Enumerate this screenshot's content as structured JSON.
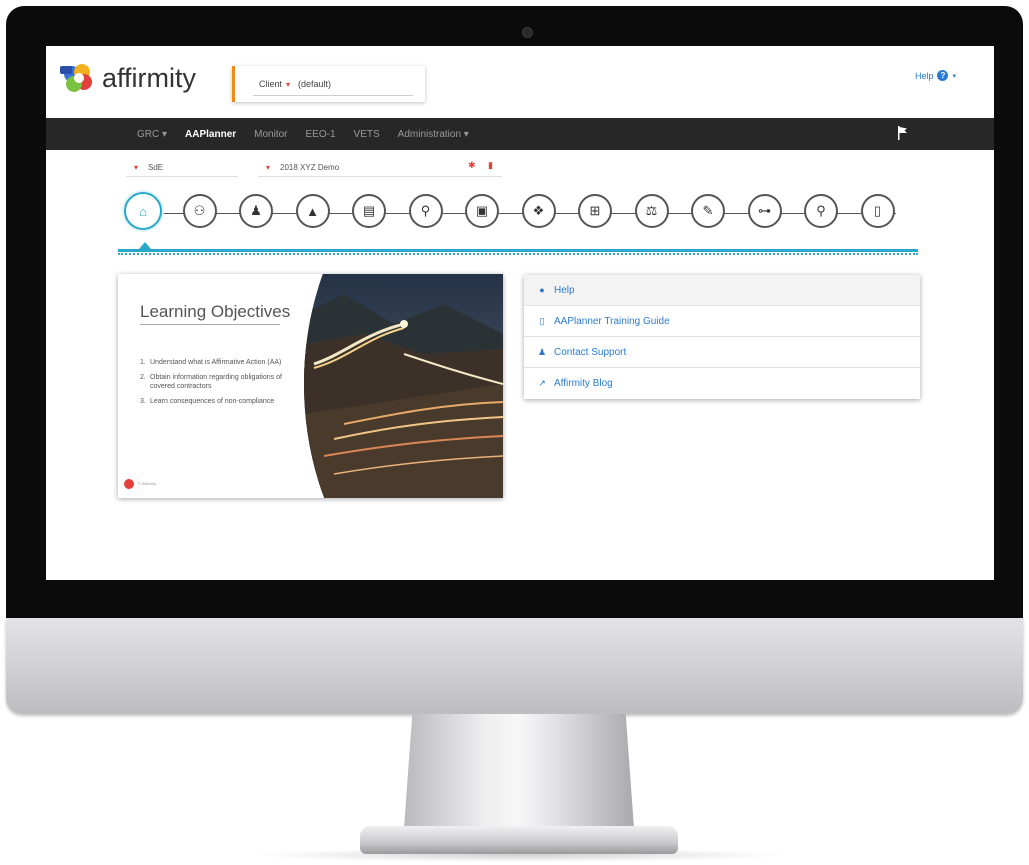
{
  "header": {
    "logo_text": "affirmity",
    "client_label": "Client",
    "client_value": "(default)",
    "help_label": "Help"
  },
  "navbar": {
    "items": [
      {
        "label": "GRC ▾",
        "active": false
      },
      {
        "label": "AAPlanner",
        "active": true
      },
      {
        "label": "Monitor",
        "active": false
      },
      {
        "label": "EEO-1",
        "active": false
      },
      {
        "label": "VETS",
        "active": false
      },
      {
        "label": "Administration ▾",
        "active": false
      }
    ]
  },
  "selectors": {
    "first_value": "SdE",
    "second_value": "2018 XYZ Demo"
  },
  "workflow_steps": [
    {
      "icon": "home-icon",
      "glyph": "⌂",
      "active": true
    },
    {
      "icon": "people-icon",
      "glyph": "⚇"
    },
    {
      "icon": "person-icon",
      "glyph": "♟"
    },
    {
      "icon": "warning-icon",
      "glyph": "▲"
    },
    {
      "icon": "calendar-icon",
      "glyph": "▤"
    },
    {
      "icon": "search-icon",
      "glyph": "⚲"
    },
    {
      "icon": "id-card-icon",
      "glyph": "▣"
    },
    {
      "icon": "handshake-icon",
      "glyph": "❖"
    },
    {
      "icon": "flowchart-icon",
      "glyph": "⊞"
    },
    {
      "icon": "scales-icon",
      "glyph": "⚖"
    },
    {
      "icon": "edit-icon",
      "glyph": "✎"
    },
    {
      "icon": "org-chart-icon",
      "glyph": "⊶"
    },
    {
      "icon": "zoom-icon",
      "glyph": "⚲"
    },
    {
      "icon": "document-icon",
      "glyph": "▯"
    }
  ],
  "learning_card": {
    "title": "Learning Objectives",
    "objectives": [
      {
        "num": "1.",
        "text": "Understand what is Affirmative Action (AA)"
      },
      {
        "num": "2.",
        "text": "Obtain information regarding obligations of covered contractors"
      },
      {
        "num": "3.",
        "text": "Learn consequences of non-compliance"
      }
    ],
    "footer": "© Affirmity"
  },
  "links_panel": {
    "items": [
      {
        "label": "Help",
        "icon": "question-circle-icon",
        "glyph": "?"
      },
      {
        "label": "AAPlanner Training Guide",
        "icon": "document-icon",
        "glyph": "▯"
      },
      {
        "label": "Contact Support",
        "icon": "user-icon",
        "glyph": "♟"
      },
      {
        "label": "Affirmity Blog",
        "icon": "external-link-icon",
        "glyph": "↗"
      }
    ]
  },
  "colors": {
    "accent": "#29a8c9",
    "link": "#2a7bd3",
    "nav_bg": "#272727",
    "client_border": "#f08a1c",
    "danger": "#e1413a"
  }
}
